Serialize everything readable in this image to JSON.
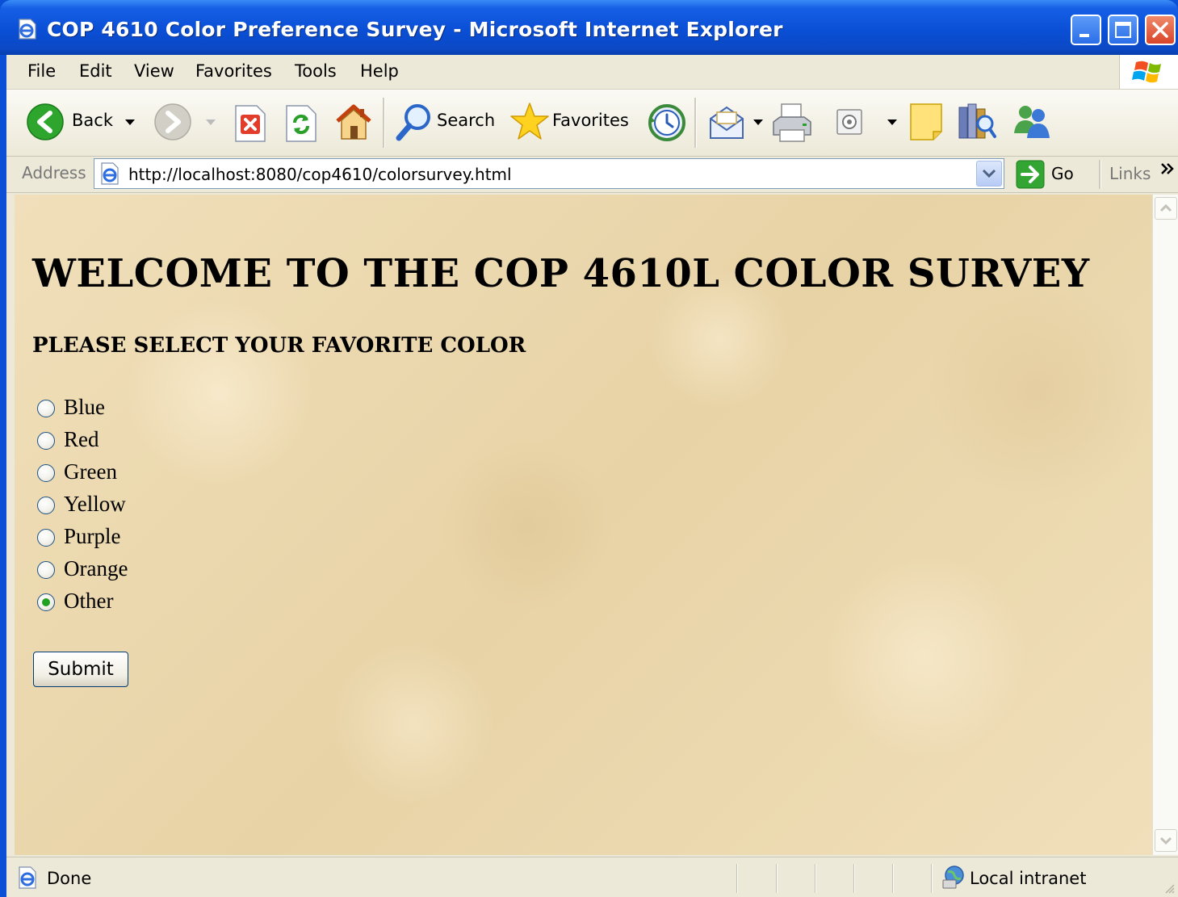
{
  "window": {
    "title": "COP 4610 Color Preference Survey - Microsoft Internet Explorer"
  },
  "menu": {
    "items": [
      "File",
      "Edit",
      "View",
      "Favorites",
      "Tools",
      "Help"
    ]
  },
  "toolbar": {
    "back_label": "Back",
    "search_label": "Search",
    "favorites_label": "Favorites"
  },
  "address": {
    "label": "Address",
    "url": "http://localhost:8080/cop4610/colorsurvey.html",
    "go_label": "Go",
    "links_label": "Links"
  },
  "page": {
    "heading": "WELCOME TO THE COP 4610L COLOR SURVEY",
    "subheading": "PLEASE SELECT YOUR FAVORITE COLOR",
    "options": [
      "Blue",
      "Red",
      "Green",
      "Yellow",
      "Purple",
      "Orange",
      "Other"
    ],
    "selected_option": "Other",
    "submit_label": "Submit"
  },
  "status": {
    "text": "Done",
    "zone": "Local intranet"
  },
  "icons": {
    "title": "ie-page-icon",
    "back": "back-arrow-icon",
    "forward": "forward-arrow-icon",
    "stop": "stop-icon",
    "refresh": "refresh-icon",
    "home": "home-icon",
    "search": "search-icon",
    "favorites": "favorites-star-icon",
    "history": "history-icon",
    "mail": "mail-icon",
    "print": "print-icon",
    "edit": "edit-icon",
    "discuss": "discuss-icon",
    "research": "research-icon",
    "messenger": "messenger-icon"
  },
  "colors": {
    "titlebar": "#0a4fd6",
    "chrome": "#ece9d8",
    "page_background": "#eedcb4",
    "close_button": "#d9452a"
  }
}
